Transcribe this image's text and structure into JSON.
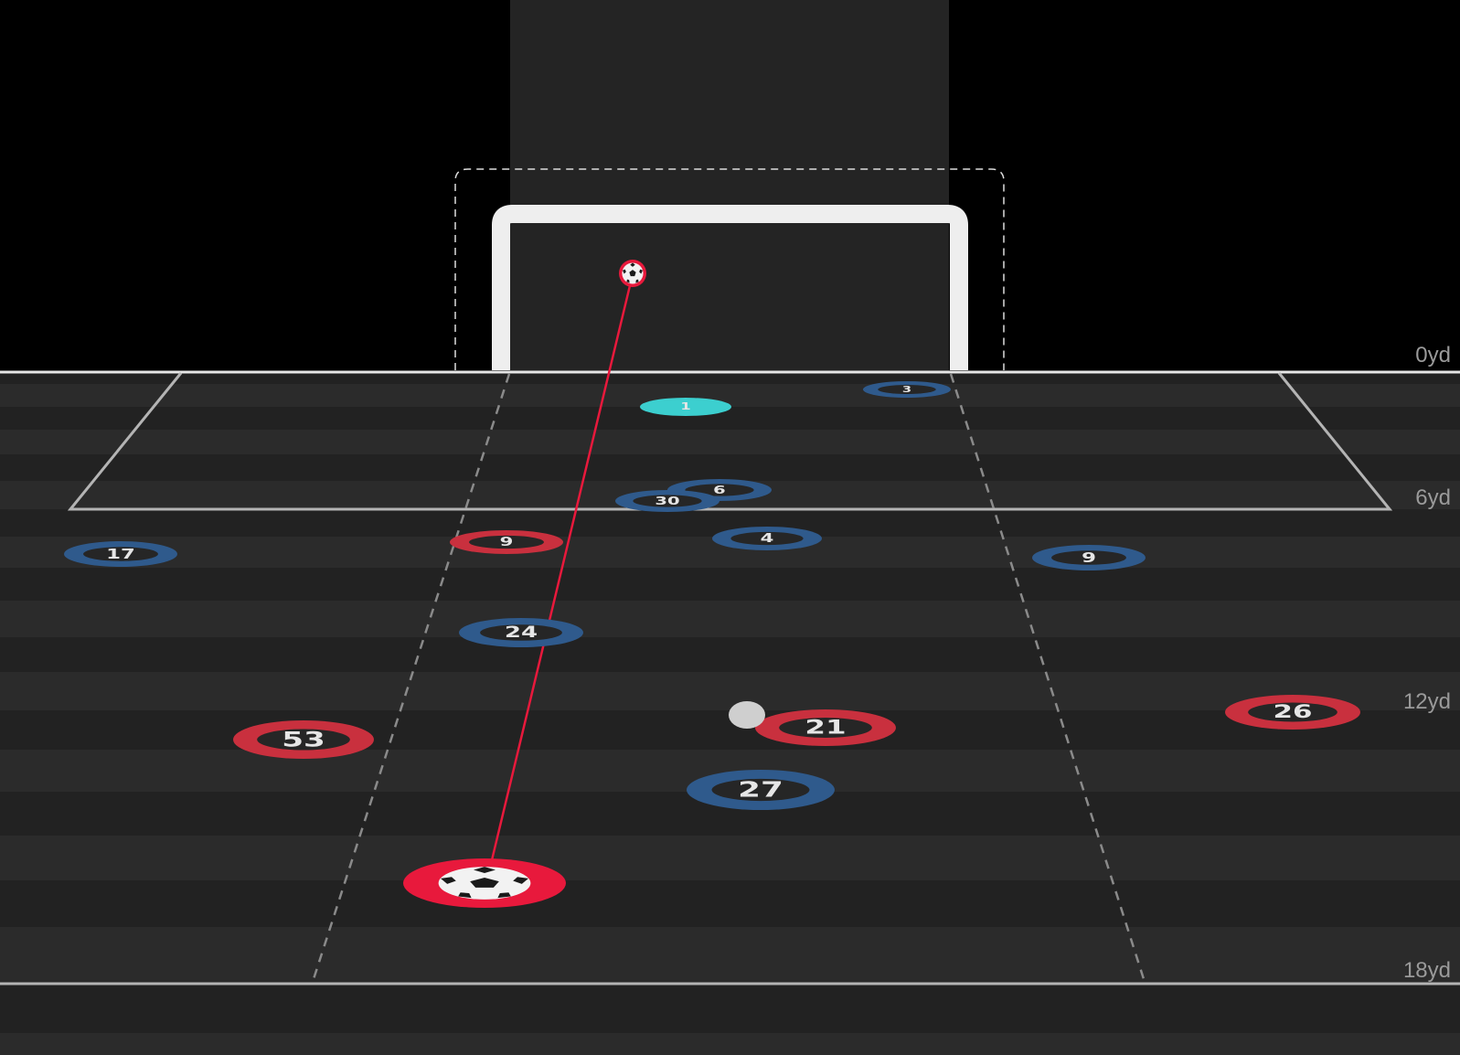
{
  "distance_labels": [
    "0yd",
    "6yd",
    "12yd",
    "18yd"
  ],
  "colors": {
    "background": "#000000",
    "goal_frame": "#eeeeee",
    "goal_backdrop": "#242424",
    "stripe_dark": "#222222",
    "stripe_light": "#2b2b2b",
    "line": "#b4b4b4",
    "team_attacking": "#c9303e",
    "team_defending": "#2f5a8c",
    "goalkeeper": "#3ccfcf",
    "shot": "#e8193c",
    "ball_marker": "#cfcfcf"
  },
  "shot": {
    "icon": "soccer-ball-icon",
    "origin_icon": "soccer-ball-icon"
  },
  "players": [
    {
      "number": "1",
      "team": "goalkeeper"
    },
    {
      "number": "3",
      "team": "defending"
    },
    {
      "number": "6",
      "team": "defending"
    },
    {
      "number": "30",
      "team": "defending"
    },
    {
      "number": "4",
      "team": "defending"
    },
    {
      "number": "9",
      "team": "attacking"
    },
    {
      "number": "17",
      "team": "defending"
    },
    {
      "number": "9",
      "team": "defending"
    },
    {
      "number": "24",
      "team": "defending"
    },
    {
      "number": "21",
      "team": "attacking"
    },
    {
      "number": "26",
      "team": "attacking"
    },
    {
      "number": "53",
      "team": "attacking"
    },
    {
      "number": "27",
      "team": "defending"
    }
  ]
}
